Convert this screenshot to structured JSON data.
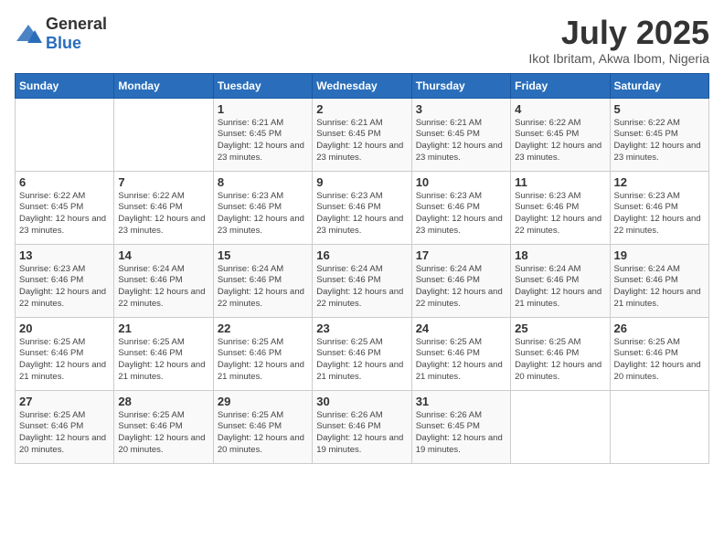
{
  "logo": {
    "general": "General",
    "blue": "Blue"
  },
  "title": "July 2025",
  "location": "Ikot Ibritam, Akwa Ibom, Nigeria",
  "days_of_week": [
    "Sunday",
    "Monday",
    "Tuesday",
    "Wednesday",
    "Thursday",
    "Friday",
    "Saturday"
  ],
  "weeks": [
    [
      {
        "day": "",
        "sunrise": "",
        "sunset": "",
        "daylight": ""
      },
      {
        "day": "",
        "sunrise": "",
        "sunset": "",
        "daylight": ""
      },
      {
        "day": "1",
        "sunrise": "Sunrise: 6:21 AM",
        "sunset": "Sunset: 6:45 PM",
        "daylight": "Daylight: 12 hours and 23 minutes."
      },
      {
        "day": "2",
        "sunrise": "Sunrise: 6:21 AM",
        "sunset": "Sunset: 6:45 PM",
        "daylight": "Daylight: 12 hours and 23 minutes."
      },
      {
        "day": "3",
        "sunrise": "Sunrise: 6:21 AM",
        "sunset": "Sunset: 6:45 PM",
        "daylight": "Daylight: 12 hours and 23 minutes."
      },
      {
        "day": "4",
        "sunrise": "Sunrise: 6:22 AM",
        "sunset": "Sunset: 6:45 PM",
        "daylight": "Daylight: 12 hours and 23 minutes."
      },
      {
        "day": "5",
        "sunrise": "Sunrise: 6:22 AM",
        "sunset": "Sunset: 6:45 PM",
        "daylight": "Daylight: 12 hours and 23 minutes."
      }
    ],
    [
      {
        "day": "6",
        "sunrise": "Sunrise: 6:22 AM",
        "sunset": "Sunset: 6:45 PM",
        "daylight": "Daylight: 12 hours and 23 minutes."
      },
      {
        "day": "7",
        "sunrise": "Sunrise: 6:22 AM",
        "sunset": "Sunset: 6:46 PM",
        "daylight": "Daylight: 12 hours and 23 minutes."
      },
      {
        "day": "8",
        "sunrise": "Sunrise: 6:23 AM",
        "sunset": "Sunset: 6:46 PM",
        "daylight": "Daylight: 12 hours and 23 minutes."
      },
      {
        "day": "9",
        "sunrise": "Sunrise: 6:23 AM",
        "sunset": "Sunset: 6:46 PM",
        "daylight": "Daylight: 12 hours and 23 minutes."
      },
      {
        "day": "10",
        "sunrise": "Sunrise: 6:23 AM",
        "sunset": "Sunset: 6:46 PM",
        "daylight": "Daylight: 12 hours and 23 minutes."
      },
      {
        "day": "11",
        "sunrise": "Sunrise: 6:23 AM",
        "sunset": "Sunset: 6:46 PM",
        "daylight": "Daylight: 12 hours and 22 minutes."
      },
      {
        "day": "12",
        "sunrise": "Sunrise: 6:23 AM",
        "sunset": "Sunset: 6:46 PM",
        "daylight": "Daylight: 12 hours and 22 minutes."
      }
    ],
    [
      {
        "day": "13",
        "sunrise": "Sunrise: 6:23 AM",
        "sunset": "Sunset: 6:46 PM",
        "daylight": "Daylight: 12 hours and 22 minutes."
      },
      {
        "day": "14",
        "sunrise": "Sunrise: 6:24 AM",
        "sunset": "Sunset: 6:46 PM",
        "daylight": "Daylight: 12 hours and 22 minutes."
      },
      {
        "day": "15",
        "sunrise": "Sunrise: 6:24 AM",
        "sunset": "Sunset: 6:46 PM",
        "daylight": "Daylight: 12 hours and 22 minutes."
      },
      {
        "day": "16",
        "sunrise": "Sunrise: 6:24 AM",
        "sunset": "Sunset: 6:46 PM",
        "daylight": "Daylight: 12 hours and 22 minutes."
      },
      {
        "day": "17",
        "sunrise": "Sunrise: 6:24 AM",
        "sunset": "Sunset: 6:46 PM",
        "daylight": "Daylight: 12 hours and 22 minutes."
      },
      {
        "day": "18",
        "sunrise": "Sunrise: 6:24 AM",
        "sunset": "Sunset: 6:46 PM",
        "daylight": "Daylight: 12 hours and 21 minutes."
      },
      {
        "day": "19",
        "sunrise": "Sunrise: 6:24 AM",
        "sunset": "Sunset: 6:46 PM",
        "daylight": "Daylight: 12 hours and 21 minutes."
      }
    ],
    [
      {
        "day": "20",
        "sunrise": "Sunrise: 6:25 AM",
        "sunset": "Sunset: 6:46 PM",
        "daylight": "Daylight: 12 hours and 21 minutes."
      },
      {
        "day": "21",
        "sunrise": "Sunrise: 6:25 AM",
        "sunset": "Sunset: 6:46 PM",
        "daylight": "Daylight: 12 hours and 21 minutes."
      },
      {
        "day": "22",
        "sunrise": "Sunrise: 6:25 AM",
        "sunset": "Sunset: 6:46 PM",
        "daylight": "Daylight: 12 hours and 21 minutes."
      },
      {
        "day": "23",
        "sunrise": "Sunrise: 6:25 AM",
        "sunset": "Sunset: 6:46 PM",
        "daylight": "Daylight: 12 hours and 21 minutes."
      },
      {
        "day": "24",
        "sunrise": "Sunrise: 6:25 AM",
        "sunset": "Sunset: 6:46 PM",
        "daylight": "Daylight: 12 hours and 21 minutes."
      },
      {
        "day": "25",
        "sunrise": "Sunrise: 6:25 AM",
        "sunset": "Sunset: 6:46 PM",
        "daylight": "Daylight: 12 hours and 20 minutes."
      },
      {
        "day": "26",
        "sunrise": "Sunrise: 6:25 AM",
        "sunset": "Sunset: 6:46 PM",
        "daylight": "Daylight: 12 hours and 20 minutes."
      }
    ],
    [
      {
        "day": "27",
        "sunrise": "Sunrise: 6:25 AM",
        "sunset": "Sunset: 6:46 PM",
        "daylight": "Daylight: 12 hours and 20 minutes."
      },
      {
        "day": "28",
        "sunrise": "Sunrise: 6:25 AM",
        "sunset": "Sunset: 6:46 PM",
        "daylight": "Daylight: 12 hours and 20 minutes."
      },
      {
        "day": "29",
        "sunrise": "Sunrise: 6:25 AM",
        "sunset": "Sunset: 6:46 PM",
        "daylight": "Daylight: 12 hours and 20 minutes."
      },
      {
        "day": "30",
        "sunrise": "Sunrise: 6:26 AM",
        "sunset": "Sunset: 6:46 PM",
        "daylight": "Daylight: 12 hours and 19 minutes."
      },
      {
        "day": "31",
        "sunrise": "Sunrise: 6:26 AM",
        "sunset": "Sunset: 6:45 PM",
        "daylight": "Daylight: 12 hours and 19 minutes."
      },
      {
        "day": "",
        "sunrise": "",
        "sunset": "",
        "daylight": ""
      },
      {
        "day": "",
        "sunrise": "",
        "sunset": "",
        "daylight": ""
      }
    ]
  ]
}
